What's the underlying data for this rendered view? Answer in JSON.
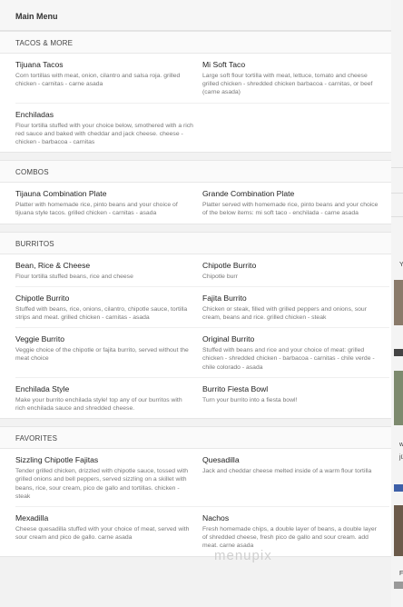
{
  "menu_title": "Main Menu",
  "watermark": "menupix",
  "sections": [
    {
      "title": "TACOS & MORE",
      "items": [
        {
          "name": "Tijuana Tacos",
          "desc": "Corn tortillas with meat, onion, cilantro and salsa roja. grilled chicken - carnitas - carne asada"
        },
        {
          "name": "Mi Soft Taco",
          "desc": "Large soft flour tortilla with meat, lettuce, tomato and cheese grilled chicken - shredded chicken barbacoa - carnitas, or beef (carne asada)"
        },
        {
          "name": "Enchiladas",
          "desc": "Flour tortilla stuffed with your choice below, smothered with a rich red sauce and baked with cheddar and jack cheese. cheese - chicken - barbacoa - carnitas"
        }
      ]
    },
    {
      "title": "COMBOS",
      "items": [
        {
          "name": "Tijauna Combination Plate",
          "desc": "Platter with homemade rice, pinto beans and your choice of tijuana style tacos. grilled chicken - carnitas - asada"
        },
        {
          "name": "Grande Combination Plate",
          "desc": "Platter served with homemade rice, pinto beans and your choice of the below items: mi soft taco - enchilada - carne asada"
        }
      ]
    },
    {
      "title": "BURRITOS",
      "items": [
        {
          "name": "Bean, Rice & Cheese",
          "desc": "Flour tortilla stuffed beans, rice and cheese"
        },
        {
          "name": "Chipotle Burrito",
          "desc": "Chipotle burr"
        },
        {
          "name": "Chipotle Burrito",
          "desc": "Stuffed with beans, rice, onions, cilantro, chipotle sauce, tortilla strips and meat. grilled chicken - carnitas - asada"
        },
        {
          "name": "Fajita Burrito",
          "desc": "Chicken or steak, filled with grilled peppers and onions, sour cream, beans and rice. grilled chicken - steak"
        },
        {
          "name": "Veggie Burrito",
          "desc": "Veggie choice of the chipotle or fajita burrito, served without the meat choice"
        },
        {
          "name": "Original Burrito",
          "desc": "Stuffed with beans and rice and your choice of meat: grilled chicken - shredded chicken - barbacoa - carnitas - chile verde - chile colorado - asada"
        },
        {
          "name": "Enchilada Style",
          "desc": "Make your burrito enchilada style! top any of our burritos with rich enchilada sauce and shredded cheese."
        },
        {
          "name": "Burrito Fiesta Bowl",
          "desc": "Turn your burrito into a fiesta bowl!"
        }
      ]
    },
    {
      "title": "FAVORITES",
      "items": [
        {
          "name": "Sizzling Chipotle Fajitas",
          "desc": "Tender grilled chicken, drizzled with chipotle sauce, tossed with grilled onions and bell peppers, served sizzling on a skillet with beans, rice, sour cream, pico de gallo and tortillas. chicken - steak"
        },
        {
          "name": "Quesadilla",
          "desc": "Jack and cheddar cheese melted inside of a warm flour tortilla"
        },
        {
          "name": "Mexadilla",
          "desc": "Cheese quesadilla stuffed with your choice of meat, served with sour cream and pico de gallo. carne asada"
        },
        {
          "name": "Nachos",
          "desc": "Fresh homemade chips, a double layer of beans, a double layer of shredded cheese, fresh pico de gallo and sour cream. add meat. carne asada"
        }
      ]
    }
  ],
  "rail_glyphs": [
    "Y",
    "w",
    "jü",
    "F"
  ]
}
